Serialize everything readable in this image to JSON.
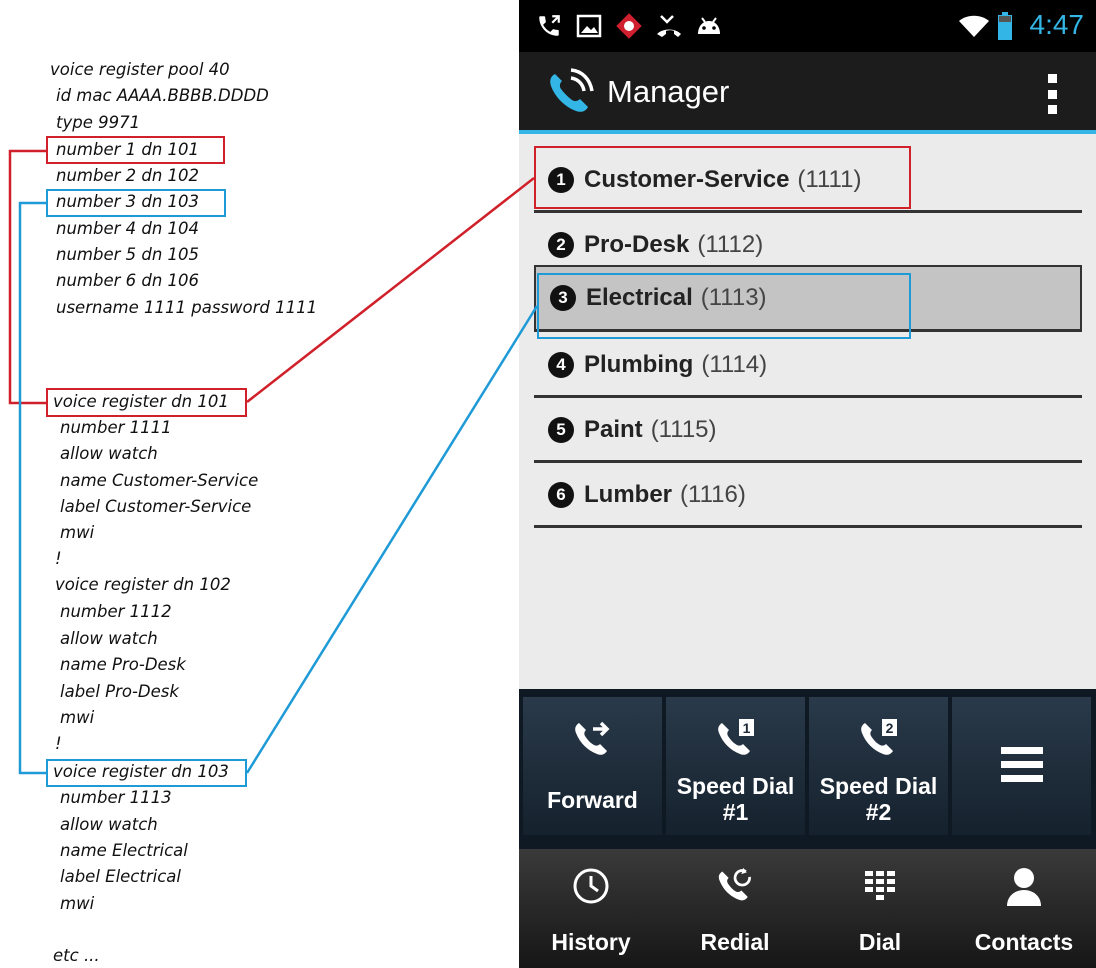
{
  "config": {
    "lines": [
      "voice register pool  40",
      "id mac AAAA.BBBB.DDDD",
      "type 9971",
      "number 1 dn 101",
      "number 2 dn 102",
      "number 3 dn 103",
      "number 4 dn 104",
      "number 5 dn 105",
      "number 6 dn 106",
      "username 1111 password 1111",
      "voice register dn  101",
      "number 1111",
      "allow watch",
      "name Customer-Service",
      "label Customer-Service",
      "mwi",
      "!",
      "voice register dn  102",
      "number 1112",
      "allow watch",
      "name Pro-Desk",
      "label Pro-Desk",
      "mwi",
      "!",
      "voice register dn  103",
      "number 1113",
      "allow watch",
      "name Electrical",
      "label Electrical",
      "mwi",
      "etc ..."
    ]
  },
  "colors": {
    "red": "#d0202a",
    "blue": "#1e9ad6",
    "accent": "#33b5e5"
  },
  "phone": {
    "status": {
      "time": "4:47",
      "icons": [
        "call-icon",
        "image-icon",
        "alert-icon",
        "missed-call-icon",
        "android-icon",
        "wifi-icon",
        "battery-icon"
      ]
    },
    "app_title": "Manager",
    "list": [
      {
        "num": "1",
        "name": "Customer-Service",
        "ext": "(1111)"
      },
      {
        "num": "2",
        "name": "Pro-Desk",
        "ext": "(1112)"
      },
      {
        "num": "3",
        "name": "Electrical",
        "ext": "(1113)"
      },
      {
        "num": "4",
        "name": "Plumbing",
        "ext": "(1114)"
      },
      {
        "num": "5",
        "name": "Paint",
        "ext": "(1115)"
      },
      {
        "num": "6",
        "name": "Lumber",
        "ext": "(1116)"
      }
    ],
    "softkeys": [
      {
        "label": "Forward",
        "icon": "call-forward-icon"
      },
      {
        "label": "Speed Dial #1",
        "icon": "speed-dial-1-icon"
      },
      {
        "label": "Speed Dial #2",
        "icon": "speed-dial-2-icon"
      },
      {
        "label": "",
        "icon": "menu-icon"
      }
    ],
    "tabs": [
      {
        "label": "History",
        "icon": "clock-icon"
      },
      {
        "label": "Redial",
        "icon": "redial-icon"
      },
      {
        "label": "Dial",
        "icon": "dialpad-icon"
      },
      {
        "label": "Contacts",
        "icon": "person-icon"
      }
    ]
  }
}
